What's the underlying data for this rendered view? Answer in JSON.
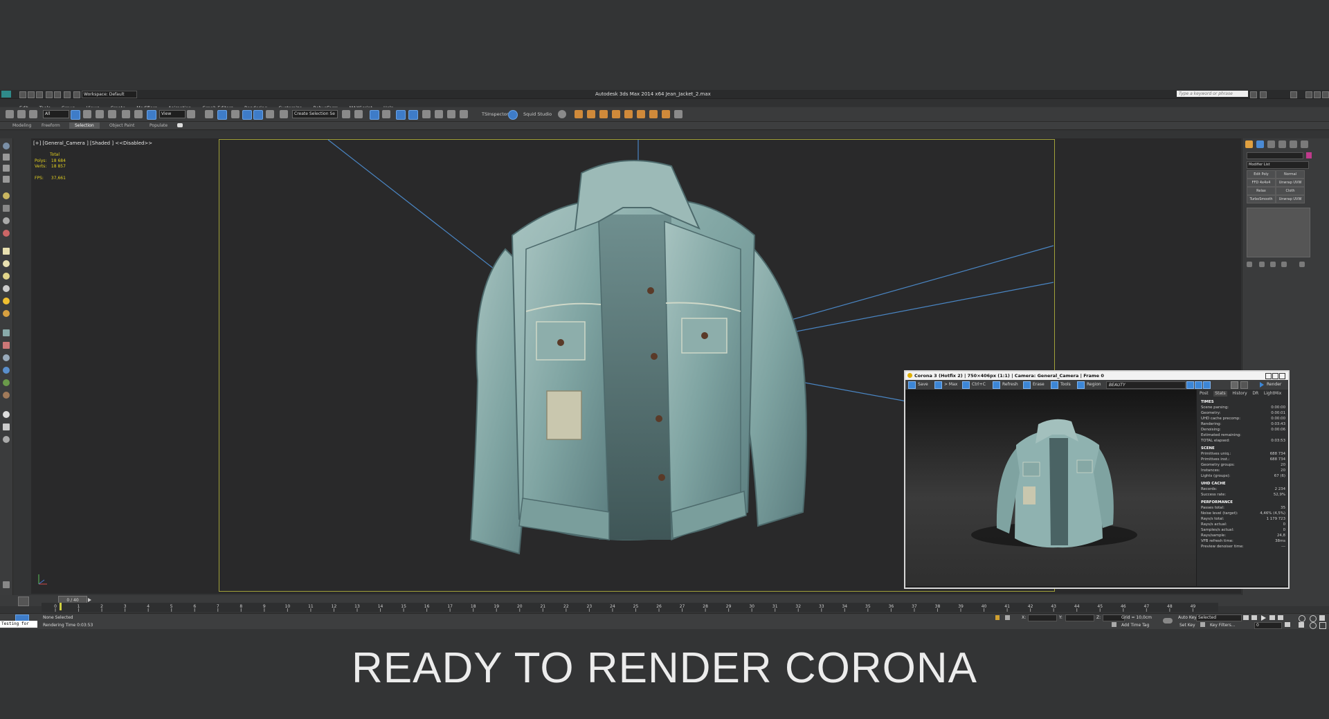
{
  "titlebar": {
    "title": "Autodesk 3ds Max  2014 x64     Jean_Jacket_2.max",
    "workspace": "Workspace: Default",
    "search_placeholder": "Type a keyword or phrase"
  },
  "menubar": {
    "items": [
      "Edit",
      "Tools",
      "Group",
      "Views",
      "Create",
      "Modifiers",
      "Animation",
      "Graph Editors",
      "Rendering",
      "Customize",
      "RebusFarm",
      "MAXScript",
      "Help"
    ]
  },
  "toolbar": {
    "filter_value": "All",
    "refcoord_value": "View",
    "selection_set_placeholder": "Create Selection Se",
    "tsinspector_label": "TSInspector",
    "squid_label": "Squid Studio"
  },
  "ribbon": {
    "tabs": [
      "Modeling",
      "Freeform",
      "Selection",
      "Object Paint",
      "Populate"
    ]
  },
  "viewport": {
    "label": "[+] [General_Camera ] [Shaded ] <<Disabled>>",
    "stats": {
      "total_label": "Total",
      "polys_label": "Polys:",
      "polys_value": "18 684",
      "verts_label": "Verts:",
      "verts_value": "18 857",
      "fps_label": "FPS:",
      "fps_value": "37,661"
    }
  },
  "command_panel": {
    "modifier_list": "Modifier List",
    "buttons": [
      "Edit Poly",
      "Normal",
      "FFD 4x4x4",
      "Unwrap UVW",
      "Relax",
      "Cloth",
      "TurboSmooth",
      "Unwrap UVW"
    ]
  },
  "vfb": {
    "title": "Corona 3 (Hotfix 2) | 750×406px (1:1) | Camera: General_Camera | Frame 0",
    "toolbar": {
      "save": "Save",
      "to_max": "> Max",
      "ctrl_c": "Ctrl+C",
      "refresh": "Refresh",
      "erase": "Erase",
      "tools": "Tools",
      "region": "Region",
      "channel": "BEAUTY",
      "render": "Render"
    },
    "tabs": [
      "Post",
      "Stats",
      "History",
      "DR",
      "LightMix"
    ],
    "sections": [
      {
        "name": "TIMES",
        "rows": [
          [
            "Scene parsing:",
            "0:00:00"
          ],
          [
            "Geometry:",
            "0:00:01"
          ],
          [
            "UHD cache precomp:",
            "0:00:00"
          ],
          [
            "Rendering:",
            "0:03:43"
          ],
          [
            "Denoising:",
            "0:00:06"
          ],
          [
            "Estimated remaining:",
            ""
          ],
          [
            "TOTAL elapsed:",
            "0:03:53"
          ]
        ]
      },
      {
        "name": "SCENE",
        "rows": [
          [
            "Primitives uniq.:",
            "688 734"
          ],
          [
            "Primitives inst.:",
            "688 734"
          ],
          [
            "Geometry groups:",
            "20"
          ],
          [
            "Instances:",
            "20"
          ],
          [
            "Lights (groups):",
            "67 (6)"
          ]
        ]
      },
      {
        "name": "UHD CACHE",
        "rows": [
          [
            "Records:",
            "2 234"
          ],
          [
            "Success rate:",
            "52,9%"
          ]
        ]
      },
      {
        "name": "PERFORMANCE",
        "rows": [
          [
            "Passes total:",
            "35"
          ],
          [
            "Noise level (target):",
            "4,46% (4,5%)"
          ],
          [
            "Rays/s total:",
            "1 179 723"
          ],
          [
            "Rays/s actual:",
            "0"
          ],
          [
            "Samples/s actual:",
            "0"
          ],
          [
            "Rays/sample:",
            "24,8"
          ],
          [
            "VFB refresh time:",
            "38ms"
          ],
          [
            "Preview denoiser time:",
            "---"
          ]
        ]
      }
    ]
  },
  "timeline": {
    "frame_counter": "0 / 40",
    "tick_labels": [
      "0",
      "1",
      "2",
      "3",
      "4",
      "5",
      "6",
      "7",
      "8",
      "9",
      "10",
      "11",
      "12",
      "13",
      "14",
      "15",
      "16",
      "17",
      "18",
      "19",
      "20",
      "21",
      "22",
      "23",
      "24",
      "25",
      "26",
      "27",
      "28",
      "29",
      "30",
      "31",
      "32",
      "33",
      "34",
      "35",
      "36",
      "37",
      "38",
      "39",
      "40",
      "41",
      "42",
      "43",
      "44",
      "45",
      "46",
      "47",
      "48",
      "49"
    ]
  },
  "status": {
    "maxscript_text": "Testing for",
    "selection": "None Selected",
    "render_time": "Rendering Time  0:03:53",
    "x_label": "X:",
    "y_label": "Y:",
    "z_label": "Z:",
    "grid": "Grid = 10,0cm",
    "add_time_tag": "Add Time Tag",
    "auto_key": "Auto Key",
    "auto_key_value": "Selected",
    "set_key": "Set Key",
    "key_filters": "Key Filters...",
    "frame_value": "0"
  },
  "caption": "READY TO RENDER CORONA",
  "colors": {
    "background": "#333435",
    "viewport": "#29292a",
    "safe_frame": "#a2a23a",
    "stats_text": "#e2d020",
    "accent_blue": "#3e7cc8",
    "denim": "#8fb2b0"
  }
}
